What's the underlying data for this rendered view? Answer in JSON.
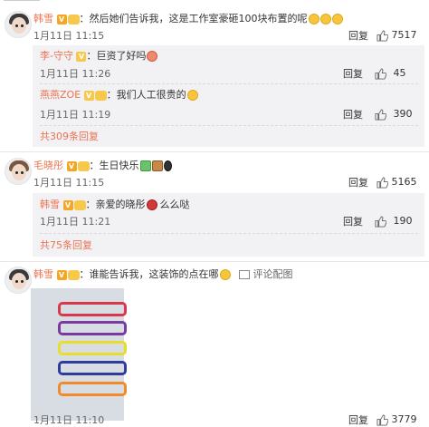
{
  "header_fragment": "",
  "c1": {
    "user": "韩雪",
    "text": "：然后她们告诉我，这是工作室豪砸100块布置的呢",
    "date": "1月11日 11:15",
    "reply": "回复",
    "likes": "7517",
    "replies": [
      {
        "user": "李-守守",
        "text": "：巨资了好吗",
        "date": "1月11日 11:26",
        "reply": "回复",
        "likes": "45"
      },
      {
        "user": "燕燕ZOE",
        "text": "：我们人工很贵的",
        "date": "1月11日 11:19",
        "reply": "回复",
        "likes": "390"
      }
    ],
    "more": "共309条回复"
  },
  "c2": {
    "user": "毛晓彤",
    "text": "：生日快乐",
    "date": "1月11日 11:15",
    "reply": "回复",
    "likes": "5165",
    "replies": [
      {
        "user": "韩雪",
        "text": "：亲爱的晓彤",
        "text2": "么么哒",
        "date": "1月11日 11:21",
        "reply": "回复",
        "likes": "190"
      }
    ],
    "more": "共75条回复"
  },
  "c3": {
    "user": "韩雪",
    "text": "：谁能告诉我，这装饰的点在哪",
    "pic_comment": "评论配图",
    "date": "1月11日 11:10",
    "reply": "回复",
    "likes": "3779"
  },
  "colors": {
    "username": "#eb7350",
    "bg_sub": "#f2f2f5"
  }
}
